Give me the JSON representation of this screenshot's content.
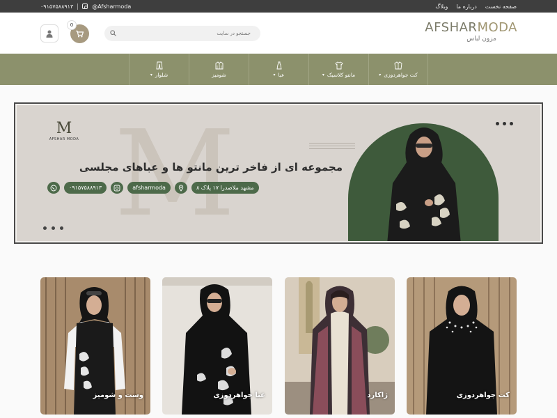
{
  "topbar": {
    "phone": "۰۹۱۵۷۵۸۸۹۱۳",
    "instagram": "@Afsharmoda",
    "links": [
      "صفحه نخست",
      "درباره ما",
      "وبلاگ"
    ]
  },
  "header": {
    "logo_main_1": "AFSHAR",
    "logo_main_2": "MODA",
    "logo_sub": "مزون لباس",
    "search_placeholder": "جستجو در سایت",
    "cart_count": "0"
  },
  "nav": {
    "items": [
      {
        "label": "کت جواهردوزی",
        "icon": "jacket-icon",
        "has_dropdown": true
      },
      {
        "label": "مانتو کلاسیک",
        "icon": "shirt-icon",
        "has_dropdown": true
      },
      {
        "label": "عبا",
        "icon": "dress-icon",
        "has_dropdown": true
      },
      {
        "label": "شومیز",
        "icon": "coat-icon",
        "has_dropdown": false
      },
      {
        "label": "شلوار",
        "icon": "pants-icon",
        "has_dropdown": true
      }
    ]
  },
  "banner": {
    "brand_mono": "M",
    "brand_name": "AFSHAR MODA",
    "big_letter": "M",
    "headline": "مجموعه ای از فاخر ترین مانتو ها و عباهای مجلسی",
    "address": "مشهد ملاصدرا ۱۷ پلاک ۸",
    "instagram": "afsharmoda",
    "phone": "۰۹۱۵۷۵۸۸۹۱۳",
    "colors": {
      "green": "#3e5a3b",
      "pill": "#4d6a4a",
      "bg": "#d9d4cf"
    }
  },
  "cards": [
    {
      "label": "کت جواهردوزی"
    },
    {
      "label": "ژاکارد"
    },
    {
      "label": "عبا جواهردوزی"
    },
    {
      "label": "وست و شومیز"
    }
  ],
  "colors": {
    "nav_bg": "#8c916c",
    "topbar_bg": "#3e3e3e",
    "accent": "#a79a80"
  }
}
